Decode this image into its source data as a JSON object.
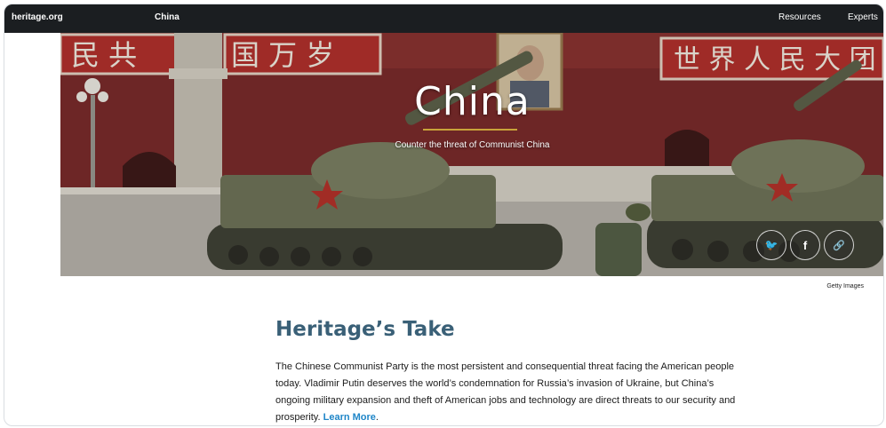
{
  "topbar": {
    "site": "heritage.org",
    "section": "China",
    "nav": [
      "Resources",
      "Experts"
    ]
  },
  "hero": {
    "title": "China",
    "subtitle": "Counter the threat of Communist China",
    "banner_left": "民 共",
    "banner_left2": "国 万 岁",
    "banner_right": "世 界 人 民 大 团",
    "share": [
      {
        "name": "twitter-icon",
        "glyph": "🐦"
      },
      {
        "name": "facebook-icon",
        "glyph": "f"
      },
      {
        "name": "link-icon",
        "glyph": "🔗"
      }
    ]
  },
  "credit": "Getty Images",
  "take": {
    "heading": "Heritage’s Take",
    "body": "The Chinese Communist Party is the most persistent and consequential threat facing the American people today. Vladimir Putin deserves the world’s condemnation for Russia’s invasion of Ukraine, but China’s ongoing military expansion and theft of American jobs and technology are direct threats to our security and prosperity.",
    "link": "Learn More",
    "link_suffix": "."
  },
  "colors": {
    "topbar": "#1b1e21",
    "heading": "#3a6077",
    "link": "#1f86c8",
    "rule": "#c9a33a"
  }
}
